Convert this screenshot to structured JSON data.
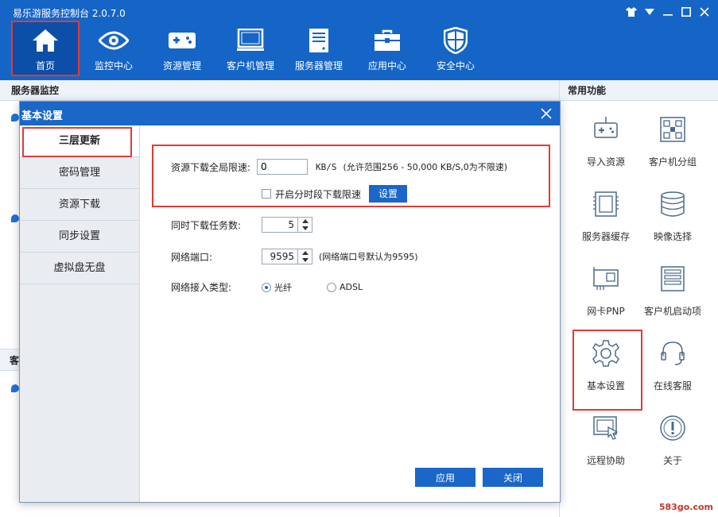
{
  "app": {
    "title": "易乐游服务控制台 2.0.7.0"
  },
  "nav": [
    {
      "label": "首页",
      "icon": "home-icon"
    },
    {
      "label": "监控中心",
      "icon": "eye-icon"
    },
    {
      "label": "资源管理",
      "icon": "gamepad-icon"
    },
    {
      "label": "客户机管理",
      "icon": "monitor-icon"
    },
    {
      "label": "服务器管理",
      "icon": "server-icon"
    },
    {
      "label": "应用中心",
      "icon": "toolbox-icon"
    },
    {
      "label": "安全中心",
      "icon": "shield-icon"
    }
  ],
  "left_panel": {
    "title": "服务器监控",
    "section2_title": "客"
  },
  "right_panel": {
    "title": "常用功能",
    "items": [
      {
        "label": "导入资源",
        "icon": "import-gamepad-icon"
      },
      {
        "label": "客户机分组",
        "icon": "client-group-icon"
      },
      {
        "label": "服务器缓存",
        "icon": "memory-icon"
      },
      {
        "label": "映像选择",
        "icon": "disk-stack-icon"
      },
      {
        "label": "网卡PNP",
        "icon": "network-card-icon"
      },
      {
        "label": "客户机启动项",
        "icon": "boot-list-icon"
      },
      {
        "label": "基本设置",
        "icon": "gear-icon"
      },
      {
        "label": "在线客服",
        "icon": "headset-icon"
      },
      {
        "label": "远程协助",
        "icon": "remote-assist-icon"
      },
      {
        "label": "关于",
        "icon": "info-icon"
      }
    ]
  },
  "watermark": "583go.com",
  "dialog": {
    "title": "基本设置",
    "sidebar": [
      "三层更新",
      "密码管理",
      "资源下载",
      "同步设置",
      "虚拟盘无盘"
    ],
    "speed_label": "资源下载全局限速:",
    "speed_value": "0",
    "speed_unit": "KB/S",
    "speed_hint": "(允许范围256 - 50,000 KB/S,0为不限速)",
    "timed_limit_label": "开启分时段下载限速",
    "settings_button": "设置",
    "tasks_label": "同时下载任务数:",
    "tasks_value": "5",
    "port_label": "网络端口:",
    "port_value": "9595",
    "port_hint": "(网络端口号默认为9595)",
    "access_label": "网络接入类型:",
    "access_options": [
      "光纤",
      "ADSL"
    ],
    "apply_button": "应用",
    "close_button": "关闭"
  }
}
